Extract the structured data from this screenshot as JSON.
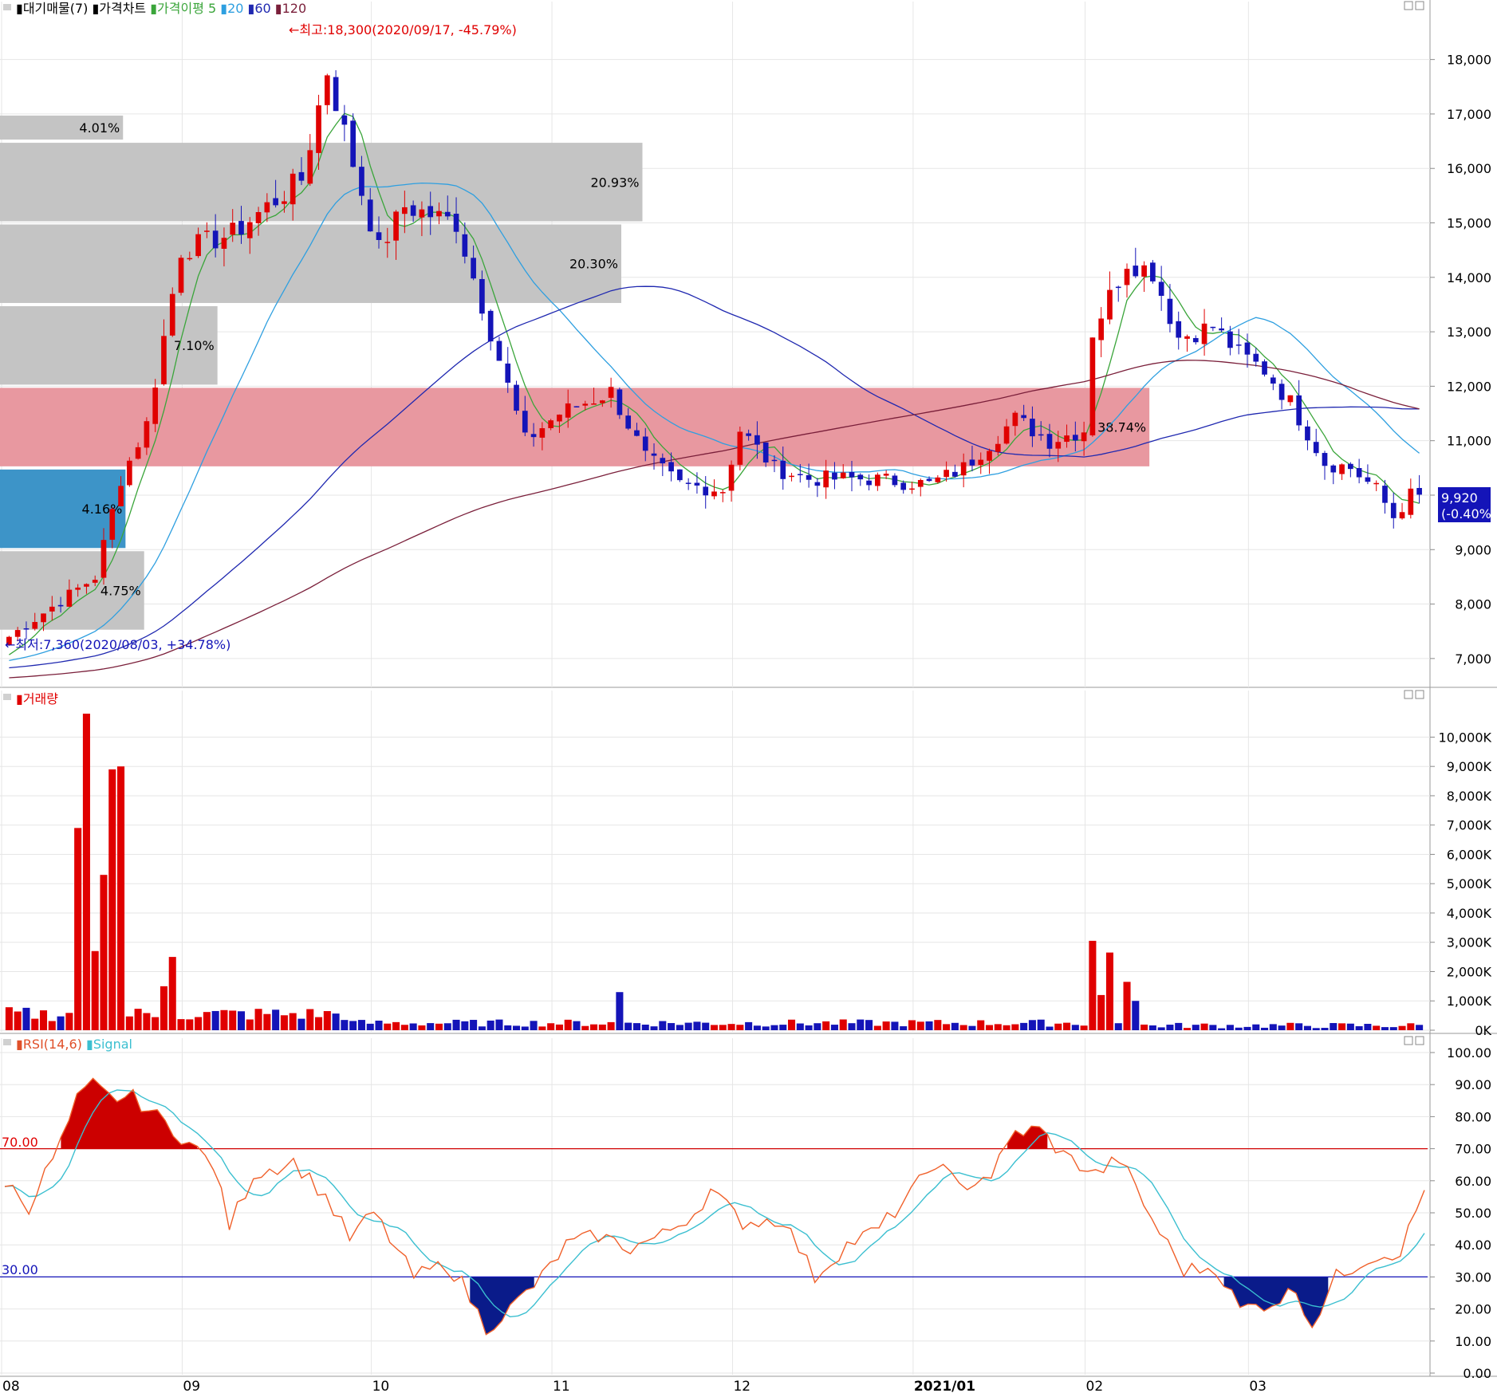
{
  "legend_price": [
    {
      "label": "대기매물(7)",
      "color": "#000000"
    },
    {
      "label": "가격차트",
      "color": "#000000"
    },
    {
      "label": "가격이평 5",
      "color": "#3aa53a"
    },
    {
      "label": "20",
      "color": "#2e9fe0"
    },
    {
      "label": "60",
      "color": "#1f28b0"
    },
    {
      "label": "120",
      "color": "#7a1f3a"
    }
  ],
  "legend_volume": {
    "label": "거래량",
    "color": "#e00000"
  },
  "legend_rsi": [
    {
      "label": "RSI(14,6)",
      "color": "#e0502a"
    },
    {
      "label": "Signal",
      "color": "#3bbfd0"
    }
  ],
  "annotations": {
    "high": "←최고:18,300(2020/09/17, -45.79%)",
    "low": "←최저:7,360(2020/08/03, +34.78%)",
    "current_price": "9,920",
    "current_change": "(-0.40%)"
  },
  "rsi_levels": {
    "upper": "70.00",
    "lower": "30.00"
  },
  "colors": {
    "up": "#e00000",
    "down": "#1414b8",
    "ma5": "#3aa53a",
    "ma20": "#2e9fe0",
    "ma60": "#1f28b0",
    "ma120": "#7a1f3a",
    "rsi": "#f0602a",
    "signal": "#3bbfd0",
    "supply_grey": "#c4c4c4",
    "supply_red": "#e898a0",
    "supply_blue": "#3d94c8"
  },
  "chart_data": [
    {
      "type": "candlestick",
      "panel": "price",
      "x_tick_labels": [
        "08",
        "09",
        "10",
        "11",
        "12",
        "2021/01",
        "02",
        "03"
      ],
      "y_ticks": [
        "7,000",
        "8,000",
        "9,000",
        "10,000",
        "11,000",
        "12,000",
        "13,000",
        "14,000",
        "15,000",
        "16,000",
        "17,000",
        "18,000"
      ],
      "ylim": [
        6500,
        18800
      ],
      "supply_zones": [
        {
          "low": 16500,
          "high": 17000,
          "label": "4.01%"
        },
        {
          "low": 15000,
          "high": 16500,
          "label": "20.93%"
        },
        {
          "low": 13500,
          "high": 15000,
          "label": "20.30%"
        },
        {
          "low": 12000,
          "high": 13500,
          "label": "7.10%"
        },
        {
          "low": 10500,
          "high": 12000,
          "label": "38.74%",
          "highlight": "current"
        },
        {
          "low": 9000,
          "high": 10500,
          "label": "4.16%",
          "highlight": "blue"
        },
        {
          "low": 7500,
          "high": 9000,
          "label": "4.75%"
        }
      ],
      "series": [
        {
          "name": "가격이평 5"
        },
        {
          "name": "20"
        },
        {
          "name": "60"
        },
        {
          "name": "120"
        }
      ]
    },
    {
      "type": "bar",
      "panel": "volume",
      "series": [
        {
          "name": "거래량"
        }
      ],
      "y_ticks": [
        "0K",
        "1,000K",
        "2,000K",
        "3,000K",
        "4,000K",
        "5,000K",
        "6,000K",
        "7,000K",
        "8,000K",
        "9,000K",
        "10,000K"
      ],
      "ylim": [
        0,
        11100
      ]
    },
    {
      "type": "line",
      "panel": "rsi",
      "series": [
        {
          "name": "RSI(14,6)"
        },
        {
          "name": "Signal"
        }
      ],
      "y_ticks": [
        "0.00",
        "10.00",
        "20.00",
        "30.00",
        "40.00",
        "50.00",
        "60.00",
        "70.00",
        "80.00",
        "90.00",
        "100.00"
      ],
      "ylim": [
        0,
        100
      ]
    }
  ]
}
